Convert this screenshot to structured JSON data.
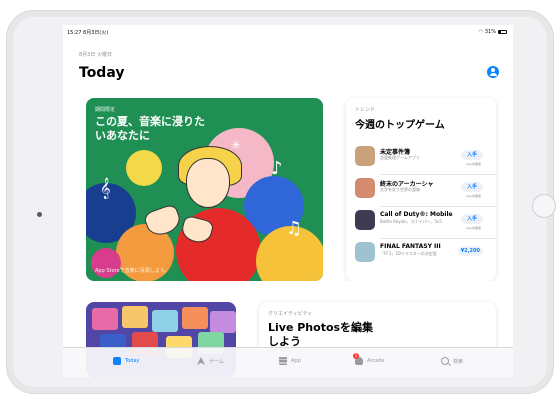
{
  "status": {
    "time": "15:27",
    "date": "8月3日(火)",
    "battery": "31%"
  },
  "header": {
    "date": "8月3日 火曜日",
    "title": "Today"
  },
  "feature": {
    "kicker": "期間限定",
    "headline": "この夏、音楽に浸りたいあなたに",
    "caption": "App Storeで音楽に没頭しよう。"
  },
  "top_games": {
    "kicker": "トレンド",
    "heading": "今週のトップゲーム",
    "items": [
      {
        "name": "未定事件簿",
        "sub": "恋愛推理ゲームアプリ",
        "action": "入手",
        "iap": "App内課金",
        "color": "#c9a27b"
      },
      {
        "name": "終末のアーカーシャ",
        "sub": "文字を失う世界の冒険",
        "action": "入手",
        "iap": "App内課金",
        "color": "#d58b6e"
      },
      {
        "name": "Call of Duty®: Mobile",
        "sub": "Battle Royale、スナイパー、5v5",
        "action": "入手",
        "iap": "App内課金",
        "color": "#3d3a52"
      },
      {
        "name": "FINAL FANTASY III",
        "sub": "「FF3」3Dリマスターの決定版",
        "action": "¥2,200",
        "iap": "",
        "color": "#9ec2cf"
      }
    ]
  },
  "second_row": {
    "kicker": "クリエイティビティ",
    "headline": "Live Photosを編集しよう"
  },
  "tabbar": {
    "tabs": [
      {
        "label": "Today",
        "icon": "today-icon"
      },
      {
        "label": "ゲーム",
        "icon": "rocket-icon"
      },
      {
        "label": "App",
        "icon": "apps-stack-icon"
      },
      {
        "label": "Arcade",
        "icon": "arcade-icon",
        "badge": "1"
      },
      {
        "label": "検索",
        "icon": "search-icon"
      }
    ]
  }
}
